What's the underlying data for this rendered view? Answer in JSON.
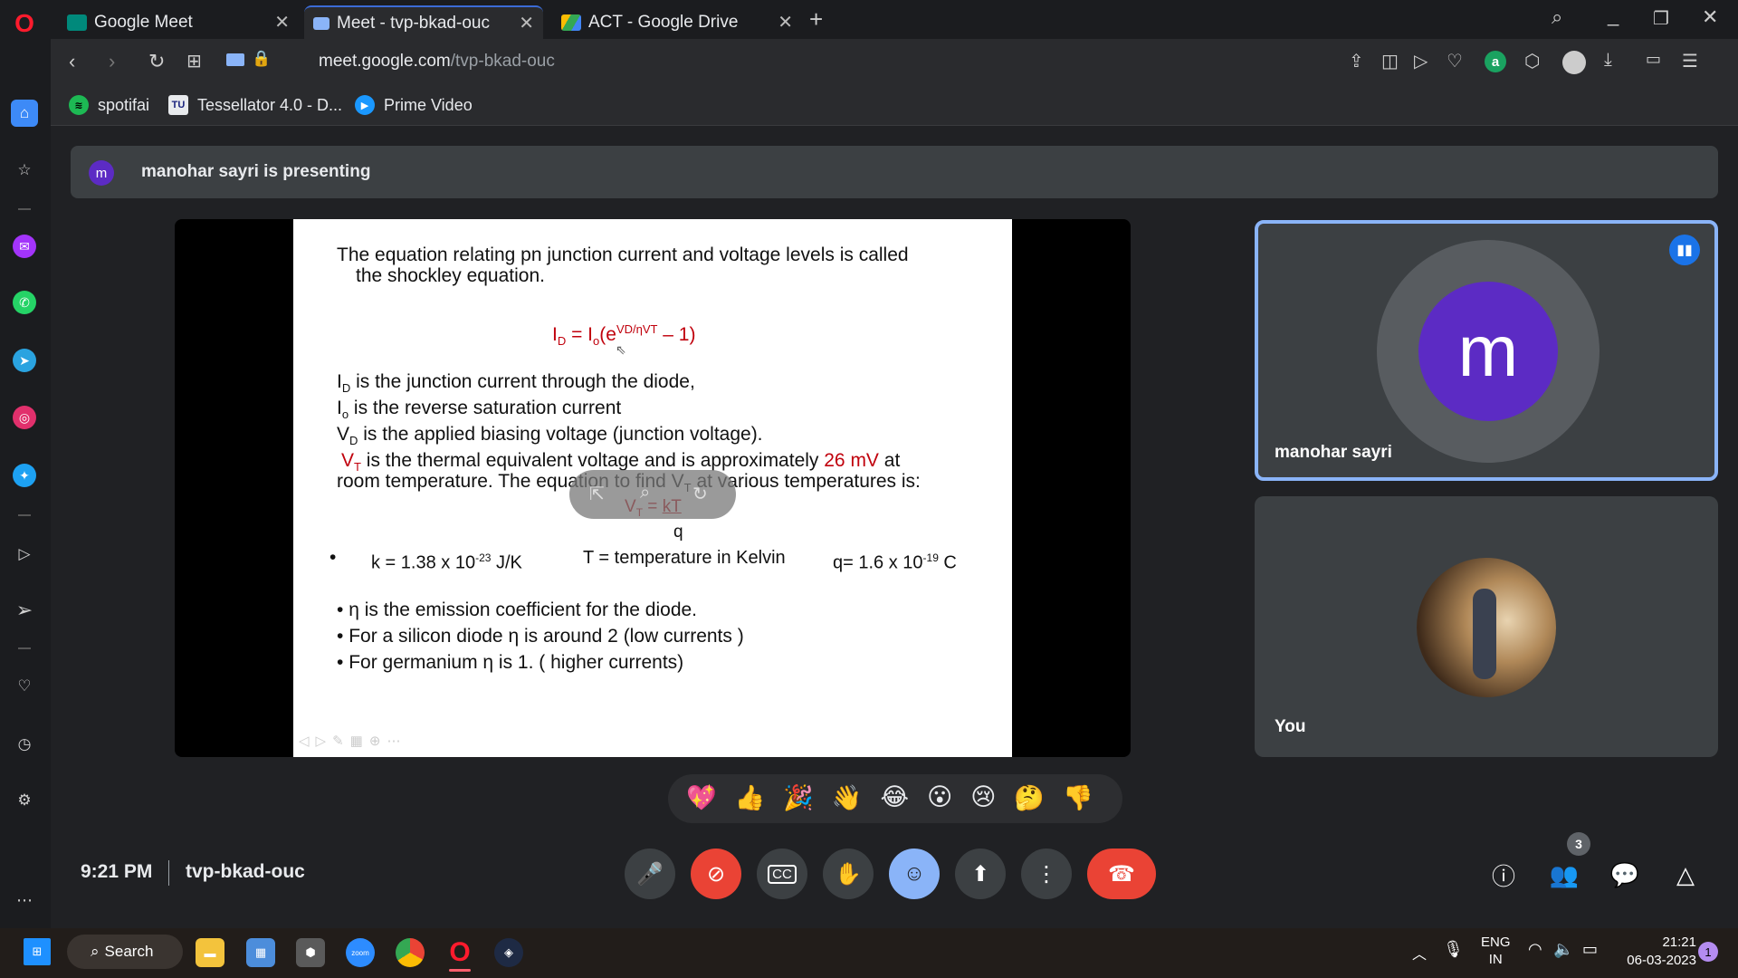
{
  "browser": {
    "tabs": [
      {
        "title": "Google Meet",
        "active": false
      },
      {
        "title": "Meet - tvp-bkad-ouc",
        "active": true
      },
      {
        "title": "ACT - Google Drive",
        "active": false
      }
    ],
    "new_tab": "+",
    "url_host": "meet.google.com",
    "url_path": "/tvp-bkad-ouc",
    "bookmarks": [
      {
        "label": "spotifai",
        "icon": "spotify-icon"
      },
      {
        "label": "Tessellator 4.0 - D...",
        "icon": "tu-icon"
      },
      {
        "label": "Prime Video",
        "icon": "prime-video-icon"
      }
    ]
  },
  "meet": {
    "presenter_initial": "m",
    "presenting_text": "manohar sayri is presenting",
    "participants": [
      {
        "name": "manohar sayri",
        "initial": "m",
        "avatar_color": "#5c2bc4",
        "speaking": true
      },
      {
        "name": "You"
      }
    ],
    "time": "9:21 PM",
    "meeting_code": "tvp-bkad-ouc",
    "people_count": "3",
    "reactions": [
      "💖",
      "👍",
      "🎉",
      "👋",
      "😂",
      "😮",
      "😢",
      "🤔",
      "👎"
    ],
    "end_call_color": "#ea4335",
    "camera_off_color": "#ea4335",
    "reactions_active_color": "#8ab4f8"
  },
  "slide": {
    "title_line1": "The equation relating pn junction current and voltage levels is called",
    "title_line2": "the shockley equation.",
    "eq_main": "I",
    "eq_main_sub": "D",
    "eq_eq": " = I",
    "eq_o": "o",
    "eq_paren": "(e",
    "eq_sup": "VD/ηVT",
    "eq_tail": " – 1)",
    "line_id_a": "I",
    "line_id_sub": "D",
    "line_id_b": " is the  junction current through the diode,",
    "line_io_a": "I",
    "line_io_sub": "o",
    "line_io_b": " is   the reverse saturation current",
    "line_vd_a": "V",
    "line_vd_sub": "D",
    "line_vd_b": " is the applied biasing voltage (junction voltage).",
    "line_vt_a": "V",
    "line_vt_sub": "T",
    "line_vt_b": " is the thermal equivalent voltage and is approximately ",
    "line_vt_red": "26 mV",
    "line_vt_c": " at",
    "line_room": "room temperature.  The equation to find V",
    "line_room_sub": "T",
    "line_room_b": " at various temperatures is:",
    "vt_eq_a": "V",
    "vt_eq_sub": "T",
    "vt_eq_b": " = ",
    "vt_eq_num": "kT",
    "vt_eq_den": "q",
    "k_text": "k = 1.38 x 10",
    "k_exp": "-23",
    "k_unit": " J/K",
    "t_text": "T = temperature in Kelvin",
    "q_text": "q= 1.6 x 10",
    "q_exp": "-19",
    "q_unit": " C",
    "bullet1": "η is the emission coefficient for the diode.",
    "bullet2": "For a silicon diode η is around 2  (low currents )",
    "bullet3_a": "For germanium η is 1.",
    "bullet3_b": "( higher currents)"
  },
  "taskbar": {
    "search": "Search",
    "lang1": "ENG",
    "lang2": "IN",
    "clock_time": "21:21",
    "clock_date": "06-03-2023",
    "notif_count": "1"
  }
}
